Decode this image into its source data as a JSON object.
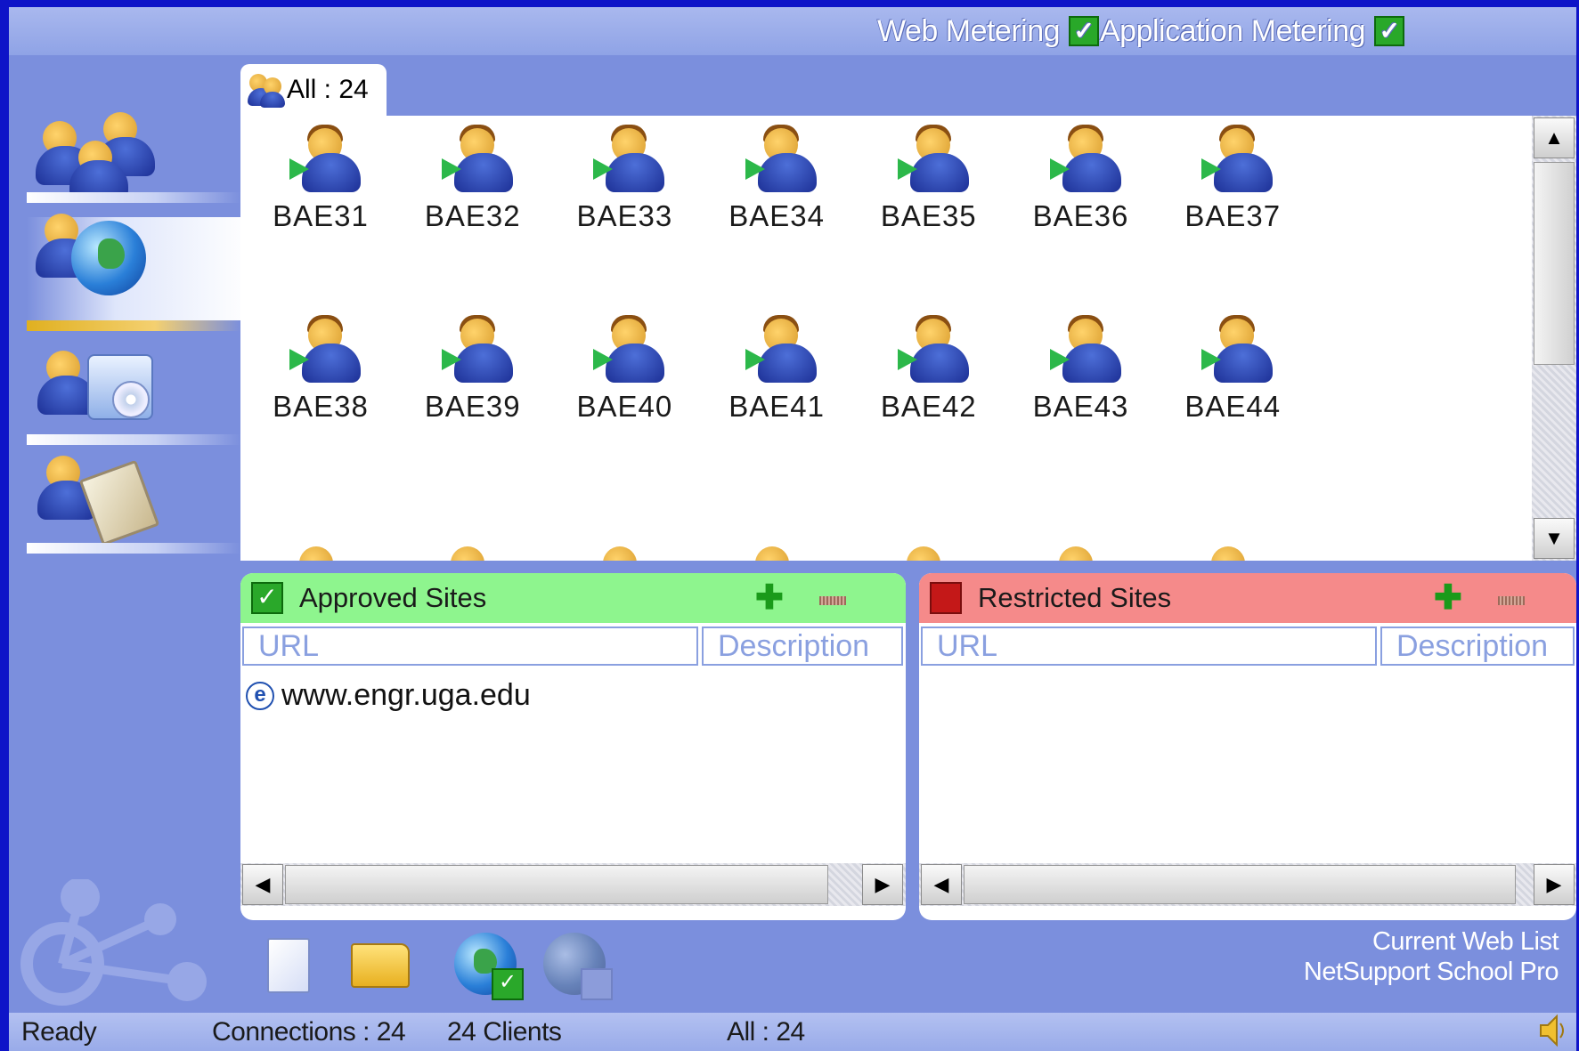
{
  "header": {
    "web_metering_label": "Web Metering",
    "application_metering_label": "Application Metering"
  },
  "nav": {
    "items": [
      {
        "icon": "users-group-icon"
      },
      {
        "icon": "user-globe-icon",
        "selected": true
      },
      {
        "icon": "user-applications-icon"
      },
      {
        "icon": "user-clipboard-icon"
      }
    ]
  },
  "tab": {
    "label": "All : 24"
  },
  "clients": [
    "BAE31",
    "BAE32",
    "BAE33",
    "BAE34",
    "BAE35",
    "BAE36",
    "BAE37",
    "BAE38",
    "BAE39",
    "BAE40",
    "BAE41",
    "BAE42",
    "BAE43",
    "BAE44"
  ],
  "approved": {
    "title": "Approved Sites",
    "col_url": "URL",
    "col_description": "Description",
    "rows": [
      {
        "url": "www.engr.uga.edu"
      }
    ]
  },
  "restricted": {
    "title": "Restricted Sites",
    "col_url": "URL",
    "col_description": "Description",
    "rows": []
  },
  "bottom_note": {
    "line1": "Current Web List",
    "line2": "NetSupport School Pro"
  },
  "status": {
    "ready": "Ready",
    "connections": "Connections : 24",
    "clients": "24 Clients",
    "all": "All : 24"
  },
  "colors": {
    "background": "#7b8fdd",
    "approved_header": "#8ef58e",
    "restricted_header": "#f58a8a",
    "accent_border": "#0e14c8"
  }
}
